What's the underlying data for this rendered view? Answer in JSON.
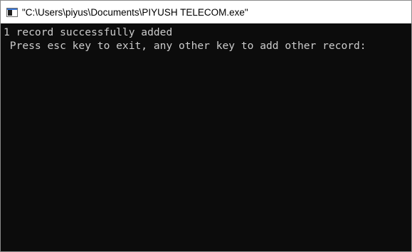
{
  "window": {
    "title": "\"C:\\Users\\piyus\\Documents\\PIYUSH TELECOM.exe\"",
    "icon": "console-app-icon"
  },
  "console": {
    "lines": [
      "1 record successfully added",
      " Press esc key to exit, any other key to add other record:"
    ],
    "text_color": "#cccccc",
    "background_color": "#0c0c0c"
  }
}
